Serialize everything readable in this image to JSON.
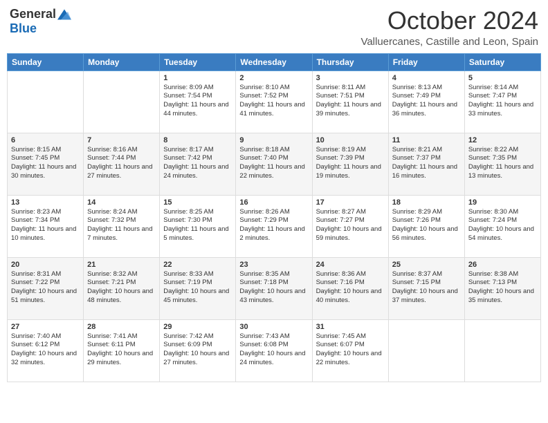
{
  "logo": {
    "general": "General",
    "blue": "Blue"
  },
  "header": {
    "month": "October 2024",
    "location": "Valluercanes, Castille and Leon, Spain"
  },
  "days_of_week": [
    "Sunday",
    "Monday",
    "Tuesday",
    "Wednesday",
    "Thursday",
    "Friday",
    "Saturday"
  ],
  "weeks": [
    [
      {
        "day": "",
        "info": ""
      },
      {
        "day": "",
        "info": ""
      },
      {
        "day": "1",
        "info": "Sunrise: 8:09 AM\nSunset: 7:54 PM\nDaylight: 11 hours and 44 minutes."
      },
      {
        "day": "2",
        "info": "Sunrise: 8:10 AM\nSunset: 7:52 PM\nDaylight: 11 hours and 41 minutes."
      },
      {
        "day": "3",
        "info": "Sunrise: 8:11 AM\nSunset: 7:51 PM\nDaylight: 11 hours and 39 minutes."
      },
      {
        "day": "4",
        "info": "Sunrise: 8:13 AM\nSunset: 7:49 PM\nDaylight: 11 hours and 36 minutes."
      },
      {
        "day": "5",
        "info": "Sunrise: 8:14 AM\nSunset: 7:47 PM\nDaylight: 11 hours and 33 minutes."
      }
    ],
    [
      {
        "day": "6",
        "info": "Sunrise: 8:15 AM\nSunset: 7:45 PM\nDaylight: 11 hours and 30 minutes."
      },
      {
        "day": "7",
        "info": "Sunrise: 8:16 AM\nSunset: 7:44 PM\nDaylight: 11 hours and 27 minutes."
      },
      {
        "day": "8",
        "info": "Sunrise: 8:17 AM\nSunset: 7:42 PM\nDaylight: 11 hours and 24 minutes."
      },
      {
        "day": "9",
        "info": "Sunrise: 8:18 AM\nSunset: 7:40 PM\nDaylight: 11 hours and 22 minutes."
      },
      {
        "day": "10",
        "info": "Sunrise: 8:19 AM\nSunset: 7:39 PM\nDaylight: 11 hours and 19 minutes."
      },
      {
        "day": "11",
        "info": "Sunrise: 8:21 AM\nSunset: 7:37 PM\nDaylight: 11 hours and 16 minutes."
      },
      {
        "day": "12",
        "info": "Sunrise: 8:22 AM\nSunset: 7:35 PM\nDaylight: 11 hours and 13 minutes."
      }
    ],
    [
      {
        "day": "13",
        "info": "Sunrise: 8:23 AM\nSunset: 7:34 PM\nDaylight: 11 hours and 10 minutes."
      },
      {
        "day": "14",
        "info": "Sunrise: 8:24 AM\nSunset: 7:32 PM\nDaylight: 11 hours and 7 minutes."
      },
      {
        "day": "15",
        "info": "Sunrise: 8:25 AM\nSunset: 7:30 PM\nDaylight: 11 hours and 5 minutes."
      },
      {
        "day": "16",
        "info": "Sunrise: 8:26 AM\nSunset: 7:29 PM\nDaylight: 11 hours and 2 minutes."
      },
      {
        "day": "17",
        "info": "Sunrise: 8:27 AM\nSunset: 7:27 PM\nDaylight: 10 hours and 59 minutes."
      },
      {
        "day": "18",
        "info": "Sunrise: 8:29 AM\nSunset: 7:26 PM\nDaylight: 10 hours and 56 minutes."
      },
      {
        "day": "19",
        "info": "Sunrise: 8:30 AM\nSunset: 7:24 PM\nDaylight: 10 hours and 54 minutes."
      }
    ],
    [
      {
        "day": "20",
        "info": "Sunrise: 8:31 AM\nSunset: 7:22 PM\nDaylight: 10 hours and 51 minutes."
      },
      {
        "day": "21",
        "info": "Sunrise: 8:32 AM\nSunset: 7:21 PM\nDaylight: 10 hours and 48 minutes."
      },
      {
        "day": "22",
        "info": "Sunrise: 8:33 AM\nSunset: 7:19 PM\nDaylight: 10 hours and 45 minutes."
      },
      {
        "day": "23",
        "info": "Sunrise: 8:35 AM\nSunset: 7:18 PM\nDaylight: 10 hours and 43 minutes."
      },
      {
        "day": "24",
        "info": "Sunrise: 8:36 AM\nSunset: 7:16 PM\nDaylight: 10 hours and 40 minutes."
      },
      {
        "day": "25",
        "info": "Sunrise: 8:37 AM\nSunset: 7:15 PM\nDaylight: 10 hours and 37 minutes."
      },
      {
        "day": "26",
        "info": "Sunrise: 8:38 AM\nSunset: 7:13 PM\nDaylight: 10 hours and 35 minutes."
      }
    ],
    [
      {
        "day": "27",
        "info": "Sunrise: 7:40 AM\nSunset: 6:12 PM\nDaylight: 10 hours and 32 minutes."
      },
      {
        "day": "28",
        "info": "Sunrise: 7:41 AM\nSunset: 6:11 PM\nDaylight: 10 hours and 29 minutes."
      },
      {
        "day": "29",
        "info": "Sunrise: 7:42 AM\nSunset: 6:09 PM\nDaylight: 10 hours and 27 minutes."
      },
      {
        "day": "30",
        "info": "Sunrise: 7:43 AM\nSunset: 6:08 PM\nDaylight: 10 hours and 24 minutes."
      },
      {
        "day": "31",
        "info": "Sunrise: 7:45 AM\nSunset: 6:07 PM\nDaylight: 10 hours and 22 minutes."
      },
      {
        "day": "",
        "info": ""
      },
      {
        "day": "",
        "info": ""
      }
    ]
  ]
}
